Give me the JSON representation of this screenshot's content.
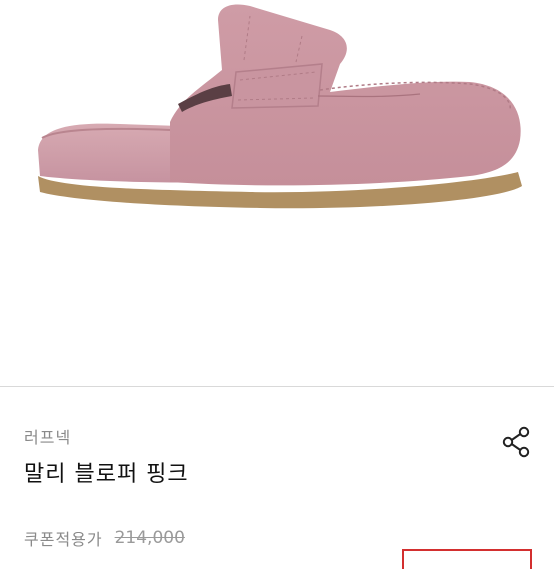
{
  "product": {
    "image_alt": "pink suede loafer mule",
    "brand": "러프넥",
    "name": "말리 블로퍼 핑크",
    "coupon_label": "쿠폰적용가",
    "original_price": "214,000"
  },
  "icons": {
    "share": "share-icon"
  },
  "colors": {
    "shoe": "#d3a3ac",
    "sole": "#b0905f",
    "accent": "#d32f2f"
  }
}
